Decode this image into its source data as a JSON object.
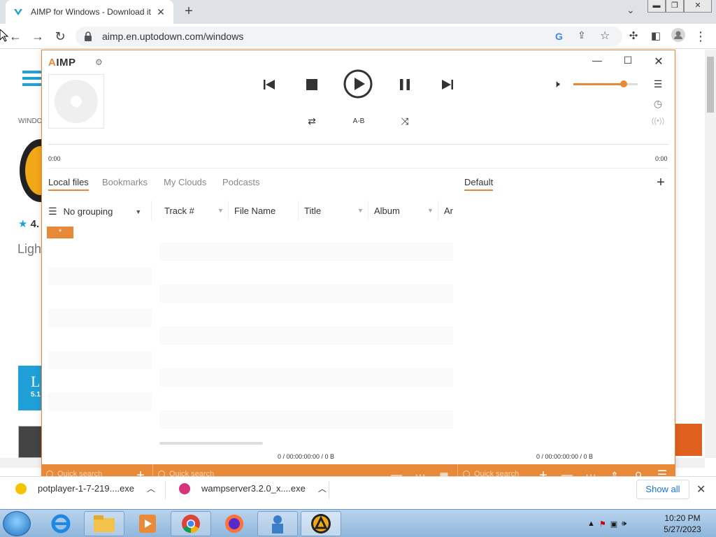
{
  "browser": {
    "tab_title": "AIMP for Windows - Download it",
    "url": "aimp.en.uptodown.com/windows",
    "new_tab": "+",
    "close_tab": "✕"
  },
  "webpage": {
    "crumb": "WINDO",
    "rating": "4.",
    "tagline": "Ligh",
    "badge_letter": "L",
    "badge_sub": "5.1"
  },
  "aimp": {
    "logo_prefix": "A",
    "logo_rest": "IMP",
    "time_start": "0:00",
    "time_end": "0:00",
    "ab_label": "A-B",
    "tabs_left": [
      "Local files",
      "Bookmarks",
      "My Clouds",
      "Podcasts"
    ],
    "tab_right": "Default",
    "grouping": "No grouping",
    "columns": [
      "Track #",
      "File Name",
      "Title",
      "Album",
      "Ar"
    ],
    "star_badge": "*",
    "stat_left": "0 / 00:00:00:00 / 0 B",
    "stat_right": "0 / 00:00:00:00 / 0 B",
    "quick_search_1": "Quick search",
    "quick_search_2": "Quick search",
    "quick_search_3": "Quick search",
    "accent": "#e8893a"
  },
  "downloads": {
    "item1": "potplayer-1-7-219....exe",
    "item2": "wampserver3.2.0_x....exe",
    "show_all": "Show all"
  },
  "taskbar": {
    "time": "10:20 PM",
    "date": "5/27/2023"
  }
}
